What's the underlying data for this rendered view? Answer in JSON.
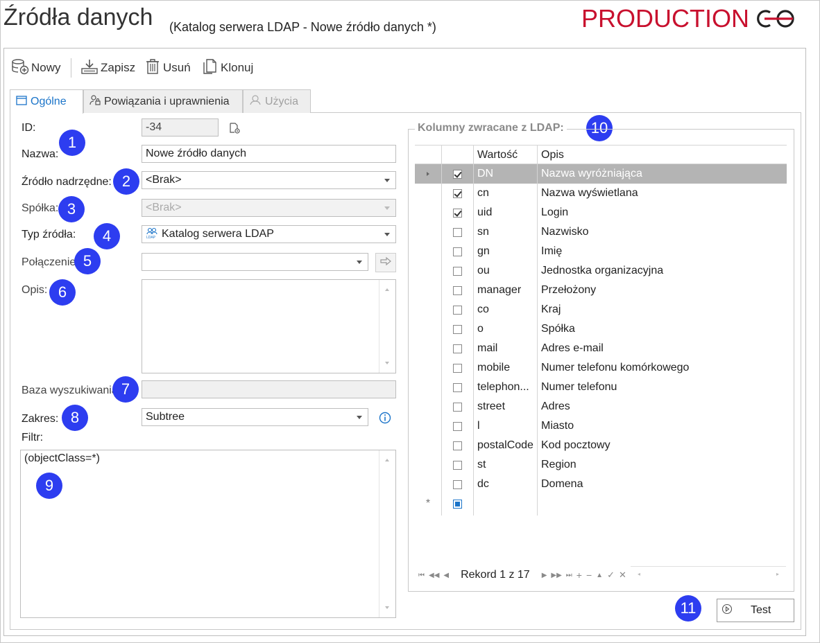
{
  "header": {
    "title": "Źródła danych",
    "subtitle": "(Katalog serwera LDAP - Nowe źródło danych *)",
    "environment": "PRODUCTION",
    "env_color": "#c8102e"
  },
  "toolbar": {
    "new_label": "Nowy",
    "save_label": "Zapisz",
    "delete_label": "Usuń",
    "clone_label": "Klonuj"
  },
  "tabs": [
    {
      "label": "Ogólne",
      "icon": "window-icon",
      "state": "active"
    },
    {
      "label": "Powiązania i uprawnienia",
      "icon": "user-lock-icon",
      "state": "normal"
    },
    {
      "label": "Użycia",
      "icon": "usage-icon",
      "state": "disabled"
    }
  ],
  "form": {
    "id_label": "ID:",
    "id_value": "-34",
    "name_label": "Nazwa:",
    "name_value": "Nowe źródło danych",
    "parent_label": "Źródło nadrzędne:",
    "parent_value": "<Brak>",
    "company_label": "Spółka:",
    "company_value": "<Brak>",
    "type_label": "Typ źródła:",
    "type_value": "Katalog serwera LDAP",
    "connection_label": "Połączenie:",
    "connection_value": "",
    "description_label": "Opis:",
    "search_base_label": "Baza wyszukiwania",
    "search_base_value": "",
    "scope_label": "Zakres:",
    "scope_value": "Subtree",
    "filter_label": "Filtr:",
    "filter_value": "(objectClass=*)"
  },
  "badges": [
    "1",
    "2",
    "3",
    "4",
    "5",
    "6",
    "7",
    "8",
    "9",
    "10",
    "11"
  ],
  "columns_group": {
    "title": "Kolumny zwracane z LDAP:",
    "headers": {
      "value": "Wartość",
      "description": "Opis"
    },
    "rows": [
      {
        "checked": true,
        "value": "DN",
        "description": "Nazwa wyróżniająca",
        "selected": true
      },
      {
        "checked": true,
        "value": "cn",
        "description": "Nazwa wyświetlana"
      },
      {
        "checked": true,
        "value": "uid",
        "description": "Login"
      },
      {
        "checked": false,
        "value": "sn",
        "description": "Nazwisko"
      },
      {
        "checked": false,
        "value": "gn",
        "description": "Imię"
      },
      {
        "checked": false,
        "value": "ou",
        "description": "Jednostka organizacyjna"
      },
      {
        "checked": false,
        "value": "manager",
        "description": "Przełożony"
      },
      {
        "checked": false,
        "value": "co",
        "description": "Kraj"
      },
      {
        "checked": false,
        "value": "o",
        "description": "Spółka"
      },
      {
        "checked": false,
        "value": "mail",
        "description": "Adres e-mail"
      },
      {
        "checked": false,
        "value": "mobile",
        "description": "Numer telefonu komórkowego"
      },
      {
        "checked": false,
        "value": "telephon...",
        "description": "Numer telefonu"
      },
      {
        "checked": false,
        "value": "street",
        "description": "Adres"
      },
      {
        "checked": false,
        "value": "l",
        "description": "Miasto"
      },
      {
        "checked": false,
        "value": "postalCode",
        "description": "Kod pocztowy"
      },
      {
        "checked": false,
        "value": "st",
        "description": "Region"
      },
      {
        "checked": false,
        "value": "dc",
        "description": "Domena"
      }
    ],
    "new_row_marker": "*",
    "record_text": "Rekord 1 z 17"
  },
  "test_button": {
    "label": "Test"
  }
}
